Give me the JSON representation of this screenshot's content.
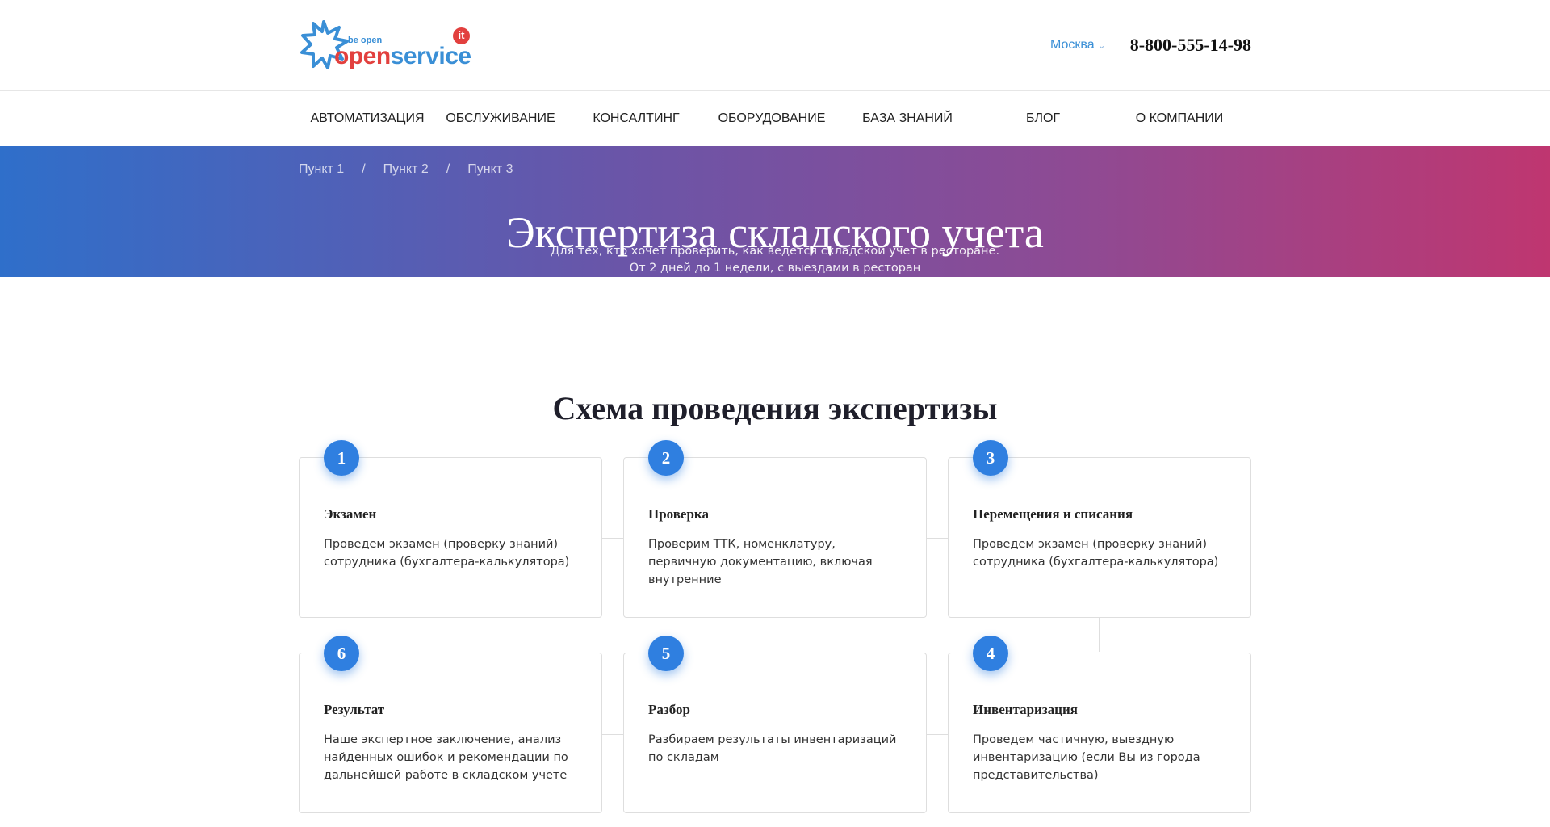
{
  "header": {
    "logo": {
      "tagline": "be open",
      "word1": "open",
      "word2": "service",
      "badge": "it"
    },
    "city": "Москва",
    "phone": "8-800-555-14-98"
  },
  "nav": {
    "items": [
      {
        "label": "Автоматизация"
      },
      {
        "label": "Обслуживание"
      },
      {
        "label": "Консалтинг"
      },
      {
        "label": "Оборудование"
      },
      {
        "label": "База знаний"
      },
      {
        "label": "Блог"
      },
      {
        "label": "О компании"
      }
    ]
  },
  "hero": {
    "breadcrumbs": [
      "Пункт 1",
      "Пункт 2",
      "Пункт 3"
    ],
    "breadcrumb_separator": "/",
    "title": "Экспертиза складского учета",
    "subtitle_line1": "Для тех, кто хочет проверить, как ведется складской учет в ресторане.",
    "subtitle_line2": "От 2 дней до 1 недели, с выездами в ресторан"
  },
  "scheme": {
    "title": "Схема проведения экспертизы",
    "steps": [
      {
        "number": "1",
        "title": "Экзамен",
        "text": "Проведем экзамен (проверку знаний) сотрудника (бухгалтера-калькулятора)"
      },
      {
        "number": "2",
        "title": "Проверка",
        "text": "Проверим ТТК, номенклатуру, первичную документацию, включая внутренние"
      },
      {
        "number": "3",
        "title": "Перемещения и списания",
        "text": "Проведем экзамен (проверку знаний) сотрудника (бухгалтера-калькулятора)"
      },
      {
        "number": "6",
        "title": "Результат",
        "text": "Наше экспертное заключение, анализ найденных ошибок и рекомендации по дальнейшей работе в складском учете"
      },
      {
        "number": "5",
        "title": "Разбор",
        "text": "Разбираем результаты инвентаризаций по складам"
      },
      {
        "number": "4",
        "title": "Инвентаризация",
        "text": "Проведем частичную, выездную инвентаризацию (если Вы из города представительства)"
      }
    ]
  },
  "colors": {
    "accent": "#2f7fe0",
    "link": "#3a8fd6",
    "logo_red": "#e2403e",
    "hero_gradient_start": "#2f6fca",
    "hero_gradient_end": "#bf3670"
  }
}
